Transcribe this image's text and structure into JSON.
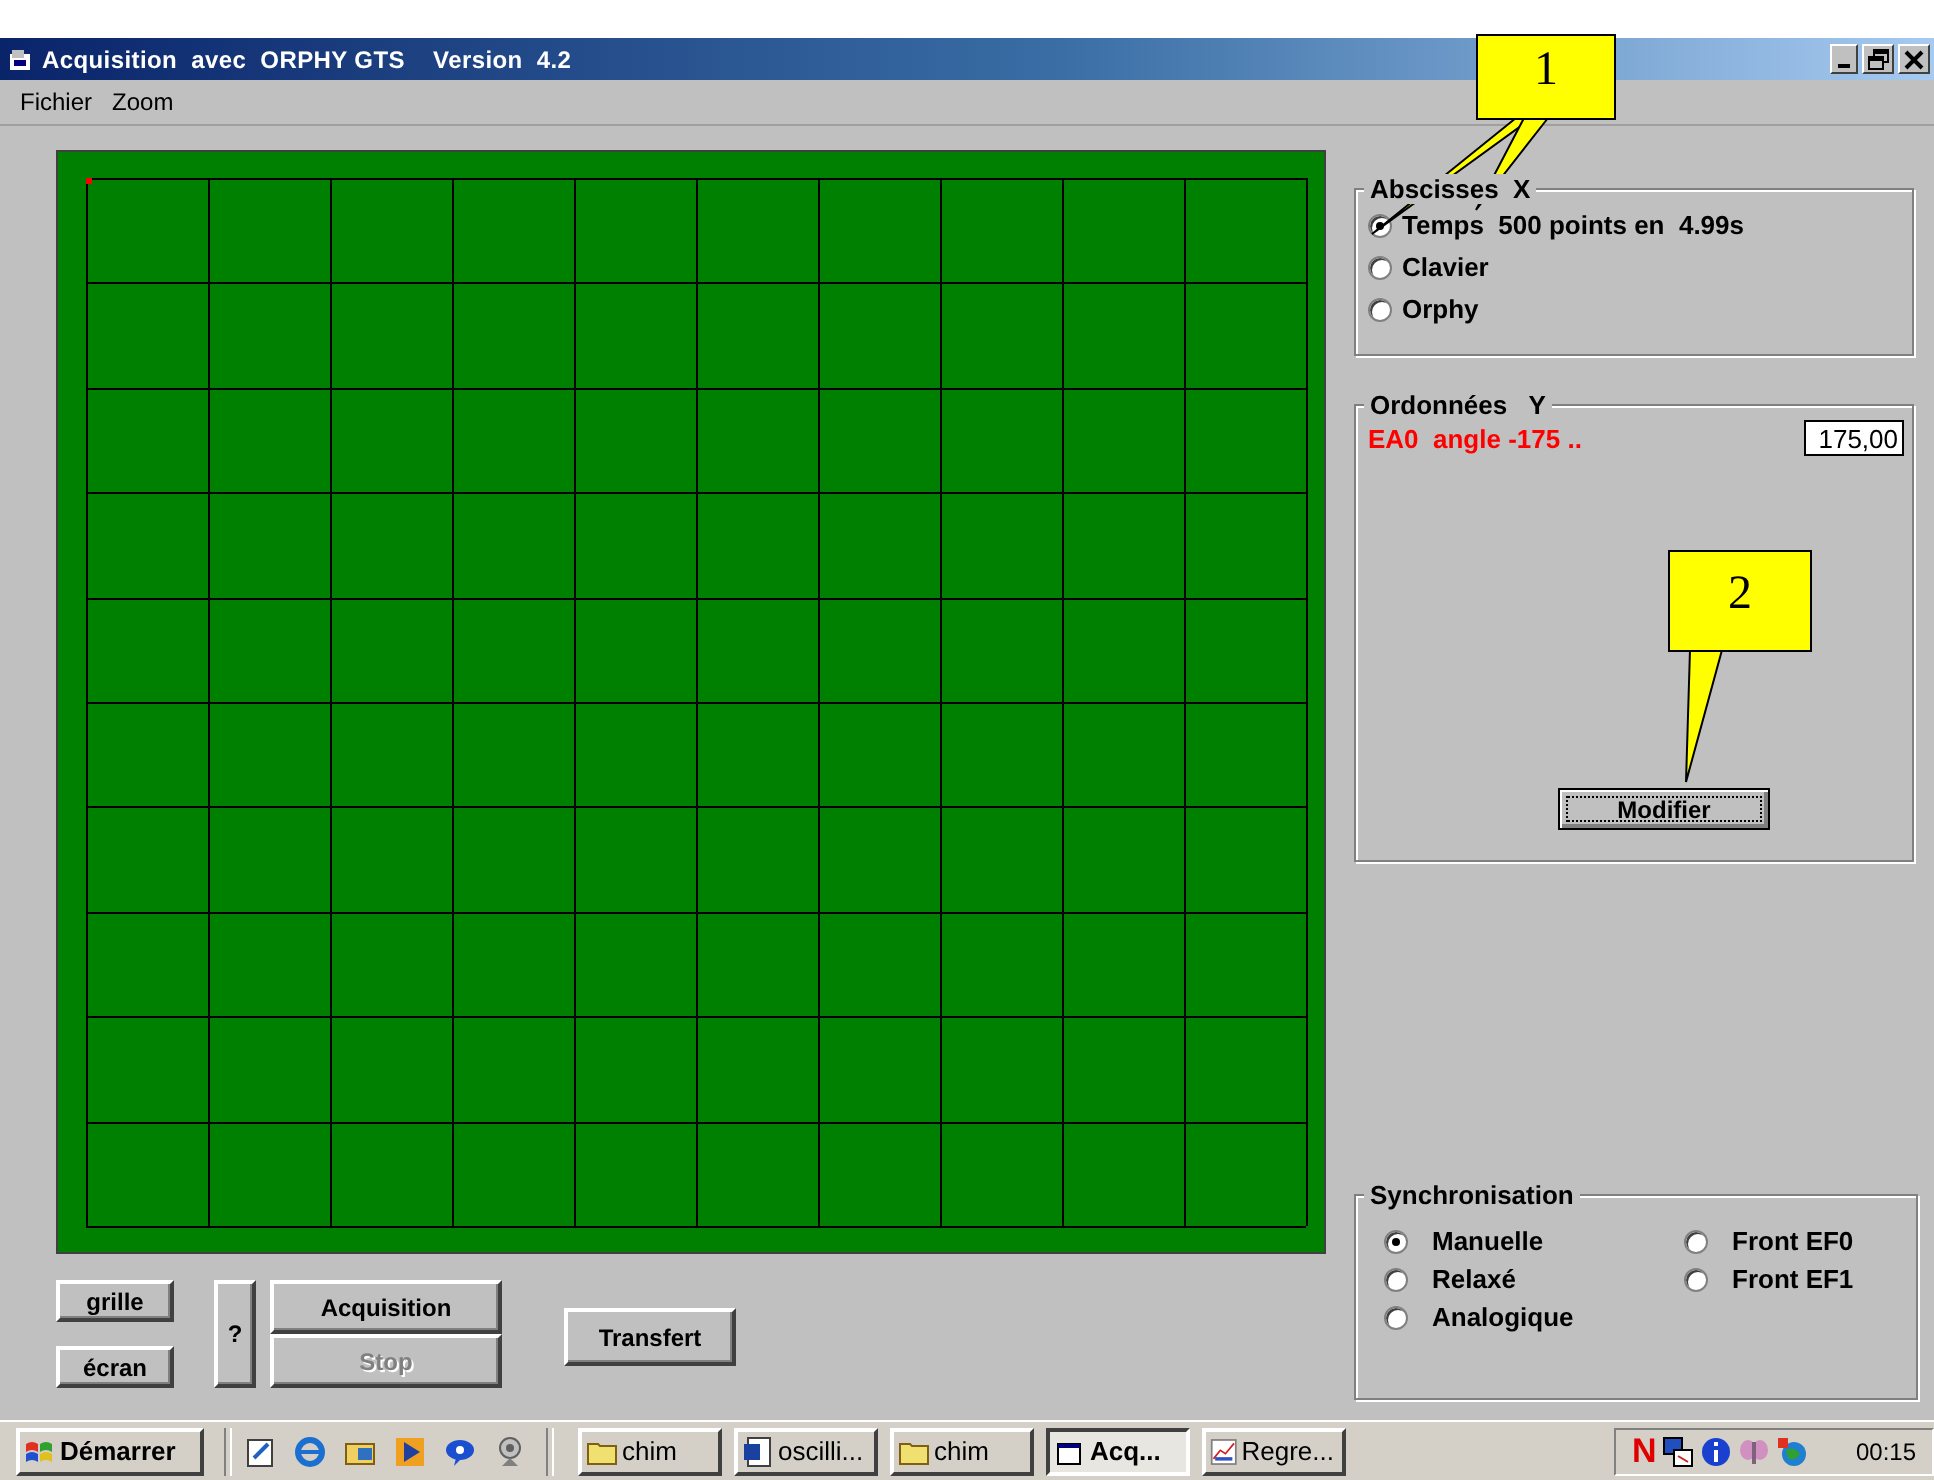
{
  "window": {
    "title": "Acquisition  avec  ORPHY GTS    Version  4.2"
  },
  "menu": [
    "Fichier",
    "Zoom"
  ],
  "abscisses": {
    "title": "Abscisses  X",
    "options": [
      {
        "label": "Temps  500 points en  4.99s",
        "selected": true
      },
      {
        "label": "Clavier",
        "selected": false
      },
      {
        "label": "Orphy",
        "selected": false
      }
    ]
  },
  "ordonnees": {
    "title": "Ordonnées   Y",
    "channel": "EA0  angle -175 ..",
    "value": "175,00",
    "button": "Modifier"
  },
  "synchronisation": {
    "title": "Synchronisation",
    "options": [
      {
        "label": "Manuelle",
        "selected": true
      },
      {
        "label": "Front EF0",
        "selected": false
      },
      {
        "label": "Relaxé",
        "selected": false
      },
      {
        "label": "Front EF1",
        "selected": false
      },
      {
        "label": "Analogique",
        "selected": false
      }
    ]
  },
  "display_buttons": [
    "grille",
    "écran"
  ],
  "help_button": "?",
  "acquisition_buttons": [
    {
      "label": "Acquisition",
      "disabled": false
    },
    {
      "label": "Stop",
      "disabled": true
    }
  ],
  "transfer_button": "Transfert",
  "callouts": [
    {
      "label": "1"
    },
    {
      "label": "2"
    }
  ],
  "taskbar": {
    "start": "Démarrer",
    "tasks": [
      {
        "label": "chim",
        "kind": "folder",
        "selected": false
      },
      {
        "label": "oscilli...",
        "kind": "document",
        "selected": false
      },
      {
        "label": "chim",
        "kind": "folder",
        "selected": false
      },
      {
        "label": "Acq...",
        "kind": "window",
        "selected": true
      },
      {
        "label": "Regre...",
        "kind": "chart",
        "selected": false
      }
    ],
    "tray_letter": "N",
    "clock": "00:15"
  }
}
